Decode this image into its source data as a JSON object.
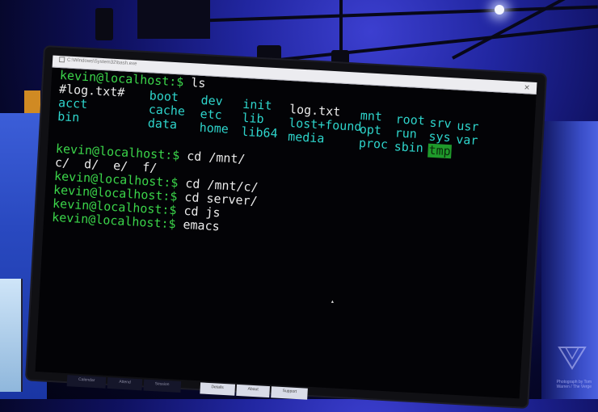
{
  "window": {
    "title": "C:\\Windows\\System32\\bash.exe",
    "close_label": "✕"
  },
  "terminal": {
    "line1": {
      "prompt": "kevin@localhost:$",
      "command": "ls"
    },
    "ls_items": [
      "#log.txt#",
      "boot",
      "dev",
      "init",
      "log.txt",
      "mnt",
      "root",
      "srv",
      "usr",
      "acct",
      "cache",
      "etc",
      "lib",
      "lost+found",
      "opt",
      "run",
      "sys",
      "var",
      "bin",
      "data",
      "home",
      "lib64",
      "media",
      "proc",
      "sbin",
      "tmp"
    ],
    "line2": {
      "prompt": "kevin@localhost:$",
      "command": "cd /mnt/"
    },
    "ls_mnt_output": "c/  d/  e/  f/",
    "line3": {
      "prompt": "kevin@localhost:$",
      "command": "cd /mnt/c/"
    },
    "line4": {
      "prompt": "kevin@localhost:$",
      "command": "cd server/"
    },
    "line5": {
      "prompt": "kevin@localhost:$",
      "command": "cd js"
    },
    "line6": {
      "prompt": "kevin@localhost:$",
      "command": "emacs"
    }
  },
  "taskbar": {
    "tabs": [
      "Calendar",
      "Attend",
      "Session",
      "Details",
      "About",
      "Support"
    ]
  },
  "watermark": {
    "text": "Photograph by Tom Warren / The Verge"
  },
  "colors": {
    "prompt_green": "#3bd54a",
    "ls_cyan": "#2ed4cb",
    "terminal_bg": "#030306",
    "stage_blue": "#2126a0"
  }
}
